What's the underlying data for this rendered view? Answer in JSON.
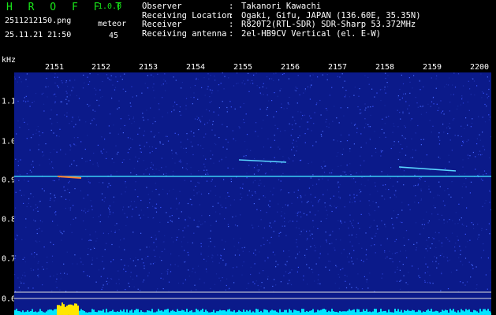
{
  "header": {
    "app_title": "H R O F F T",
    "version": "1.0.0",
    "file_name": "2511212150.png",
    "timestamp": "25.11.21 21:50",
    "meteor_label": "meteor",
    "meteor_count": "45"
  },
  "info": [
    {
      "key": "Observer",
      "sep": ":",
      "value": "Takanori Kawachi"
    },
    {
      "key": "Receiving Location",
      "sep": ":",
      "value": "Ogaki, Gifu, JAPAN (136.60E, 35.35N)"
    },
    {
      "key": "Receiver",
      "sep": ":",
      "value": "R820T2(RTL-SDR) SDR-Sharp 53.372MHz"
    },
    {
      "key": "Receiving antenna",
      "sep": ":",
      "value": "2el-HB9CV Vertical (el. E-W)"
    }
  ],
  "axis": {
    "y_unit": "kHz",
    "x_ticks": [
      "2151",
      "2152",
      "2153",
      "2154",
      "2155",
      "2156",
      "2157",
      "2158",
      "2159",
      "2200"
    ],
    "y_ticks": [
      "1.1",
      "1.0",
      "0.9",
      "0.8",
      "0.7",
      "0.6"
    ]
  },
  "colors": {
    "title_green": "#19e619",
    "background": "#0b1a8a",
    "carrier_line": "#40e0ff",
    "bottom_bar_cyan": "#00e5ff",
    "bottom_bar_yellow": "#ffe600",
    "grid_line": "#e0e0e0"
  }
}
